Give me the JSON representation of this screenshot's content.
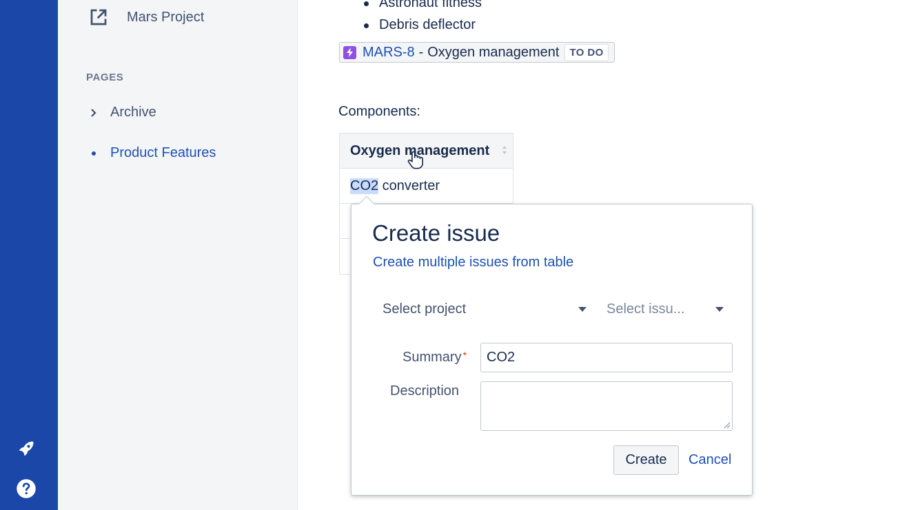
{
  "colors": {
    "rail": "#1b48a8",
    "sidebar": "#f4f5f7",
    "link": "#1d4fb5",
    "epic": "#904ee2",
    "selection": "#c9dcff",
    "required": "#de350b"
  },
  "rail": {
    "top_icon": "rocket-icon",
    "bottom_icon": "help-icon"
  },
  "sidebar": {
    "space_link": {
      "icon": "external-link-icon",
      "label": "Mars Project"
    },
    "pages_heading": "PAGES",
    "pages": [
      {
        "label": "Archive",
        "icon": "chevron-right-icon",
        "active": false
      },
      {
        "label": "Product Features",
        "icon": "bullet-dot",
        "active": true
      }
    ]
  },
  "content": {
    "bullets": [
      "Astronaut fitness",
      "Debris deflector"
    ],
    "jira_issue": {
      "key": "MARS-8",
      "separator": "-",
      "summary": "Oxygen management",
      "status": "TO DO",
      "icon": "epic-lightning-icon"
    },
    "components_label": "Components:",
    "table": {
      "header": "Oxygen management",
      "rows": [
        {
          "highlighted": "CO2",
          "rest": " converter"
        },
        {
          "highlighted": "",
          "rest": ""
        },
        {
          "highlighted": "",
          "rest": ""
        }
      ]
    }
  },
  "popup": {
    "title": "Create issue",
    "multi_link": "Create multiple issues from table",
    "project_select": "Select project",
    "issuetype_select": "Select issu...",
    "summary_label": "Summary",
    "required_mark": "*",
    "summary_value": "CO2",
    "description_label": "Description",
    "description_value": "",
    "create_button": "Create",
    "cancel_link": "Cancel"
  }
}
